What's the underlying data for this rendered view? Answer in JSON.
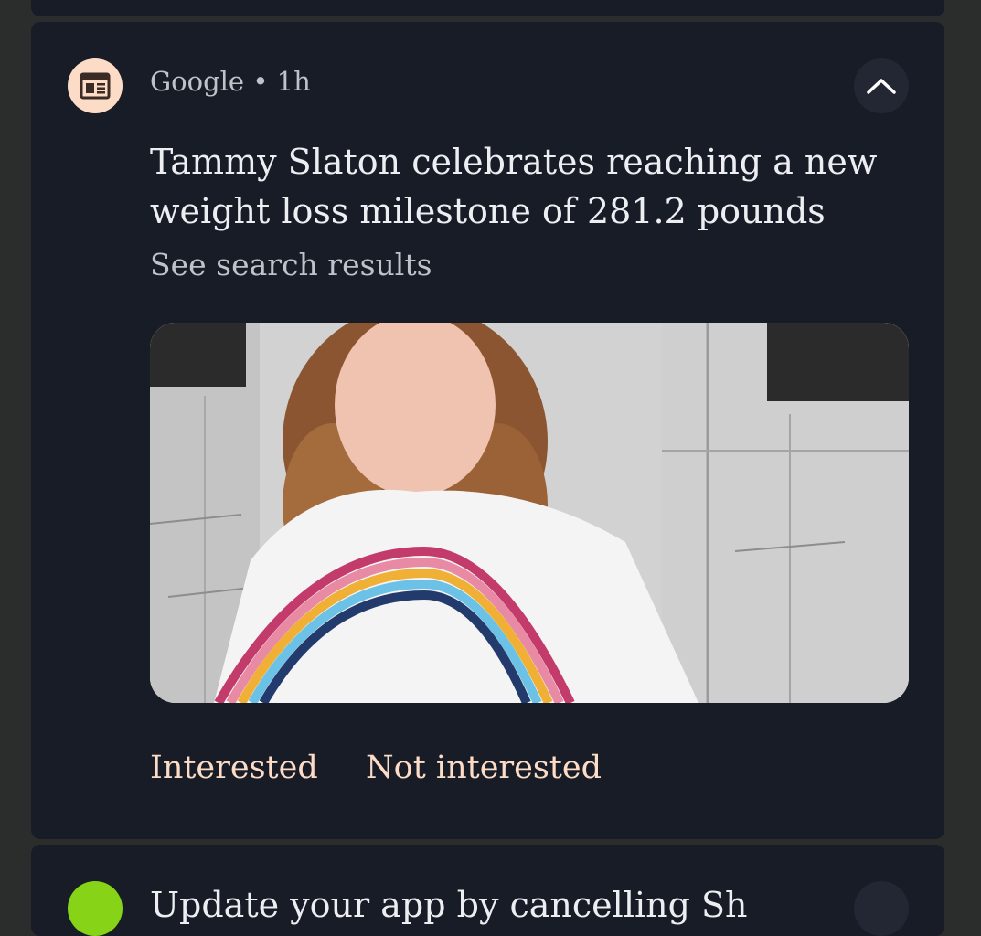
{
  "notification": {
    "app_name": "Google",
    "separator": "•",
    "time": "1h",
    "app_icon": "news-feed-icon",
    "collapse_icon": "chevron-up-icon",
    "headline": "Tammy Slaton celebrates reaching a new weight loss milestone of 281.2 pounds",
    "subtext": "See search results",
    "image_description_icon": "article-thumbnail",
    "actions": {
      "interested": "Interested",
      "not_interested": "Not interested"
    }
  },
  "next_notification": {
    "title_partial": "Update your app by cancelling Sh"
  },
  "colors": {
    "background": "#2b2c2c",
    "card": "#181c26",
    "accent": "#fcdcc7",
    "text_primary": "#eceef2",
    "text_secondary": "#bfc2c8",
    "next_icon": "#86d317"
  }
}
